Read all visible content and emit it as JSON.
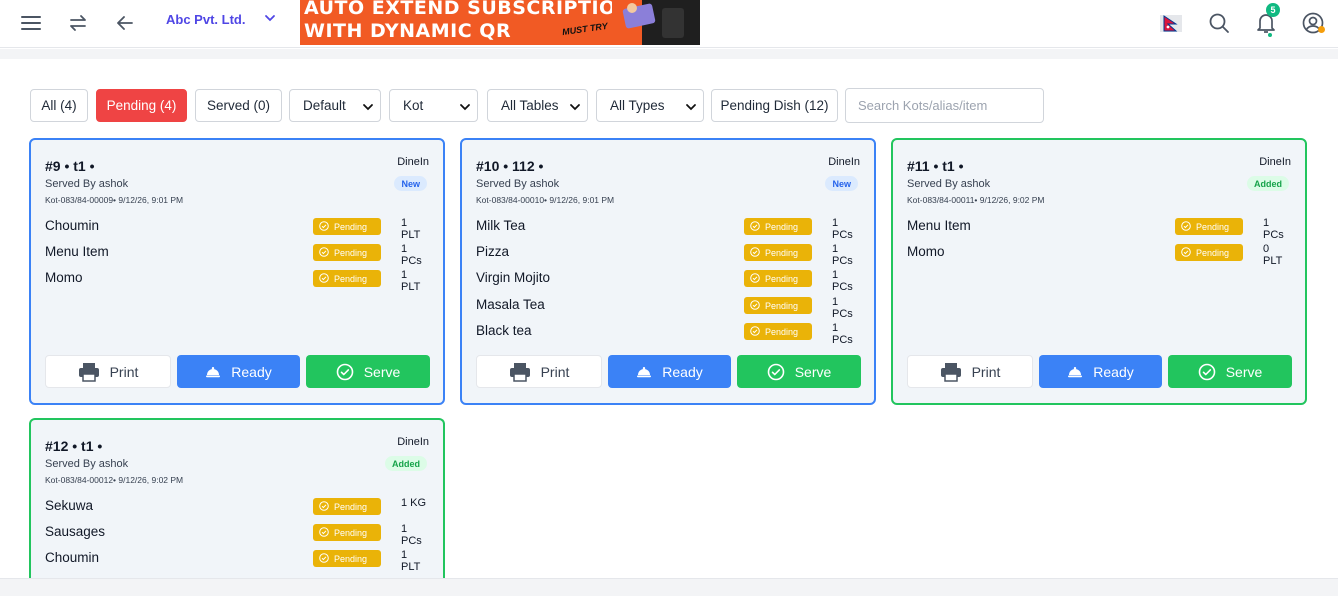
{
  "company": {
    "name": "Abc Pvt. Ltd."
  },
  "banner": {
    "line1": "AUTO EXTEND SUBSCRIPTION",
    "line2": "WITH DYNAMIC QR",
    "tag": "MUST TRY"
  },
  "topbar": {
    "icons": [
      "menu-icon",
      "swap-icon",
      "back-arrow-icon",
      "chevron-down-icon",
      "nepal-flag-icon",
      "search-icon",
      "bell-icon",
      "user-icon"
    ],
    "notification_count": "5"
  },
  "filters": {
    "tabs": [
      {
        "label": "All (4)"
      },
      {
        "label": "Pending (4)",
        "active": true
      },
      {
        "label": "Served (0)"
      }
    ],
    "selects": [
      {
        "value": "Default"
      },
      {
        "value": "Kot"
      },
      {
        "value": "All Tables"
      },
      {
        "value": "All Types"
      }
    ],
    "pending_dish": "Pending Dish (12)",
    "search_placeholder": "Search Kots/alias/item"
  },
  "colors": {
    "accent": "#ef4444",
    "blue": "#3b82f6",
    "green": "#22c55e",
    "pending": "#eab308"
  },
  "actions": {
    "print": "Print",
    "ready": "Ready",
    "serve": "Serve"
  },
  "pending_label": "Pending",
  "cards": [
    {
      "title": "#9 • t1 •",
      "type": "DineIn",
      "served_by": "Served By ashok",
      "kot": "Kot-083/84-00009• 9/12/26, 9:01 PM",
      "badge": "New",
      "items": [
        {
          "name": "Choumin",
          "qty": "1 PLT"
        },
        {
          "name": "Menu Item",
          "qty": "1 PCs"
        },
        {
          "name": "Momo",
          "qty": "1 PLT"
        }
      ]
    },
    {
      "title": "#10 • 112 •",
      "type": "DineIn",
      "served_by": "Served By ashok",
      "kot": "Kot-083/84-00010• 9/12/26, 9:01 PM",
      "badge": "New",
      "items": [
        {
          "name": "Milk Tea",
          "qty": "1 PCs"
        },
        {
          "name": "Pizza",
          "qty": "1 PCs"
        },
        {
          "name": "Virgin Mojito",
          "qty": "1 PCs"
        },
        {
          "name": "Masala Tea",
          "qty": "1 PCs"
        },
        {
          "name": "Black tea",
          "qty": "1 PCs"
        }
      ]
    },
    {
      "title": "#11 • t1 •",
      "type": "DineIn",
      "served_by": "Served By ashok",
      "kot": "Kot-083/84-00011• 9/12/26, 9:02 PM",
      "badge": "Added",
      "items": [
        {
          "name": "Menu Item",
          "qty": "1 PCs"
        },
        {
          "name": "Momo",
          "qty": "0 PLT"
        }
      ]
    },
    {
      "title": "#12 • t1 •",
      "type": "DineIn",
      "served_by": "Served By ashok",
      "kot": "Kot-083/84-00012• 9/12/26, 9:02 PM",
      "badge": "Added",
      "items": [
        {
          "name": "Sekuwa",
          "qty": "1 KG"
        },
        {
          "name": "Sausages",
          "qty": "1 PCs"
        },
        {
          "name": "Choumin",
          "qty": "1 PLT"
        }
      ]
    }
  ]
}
